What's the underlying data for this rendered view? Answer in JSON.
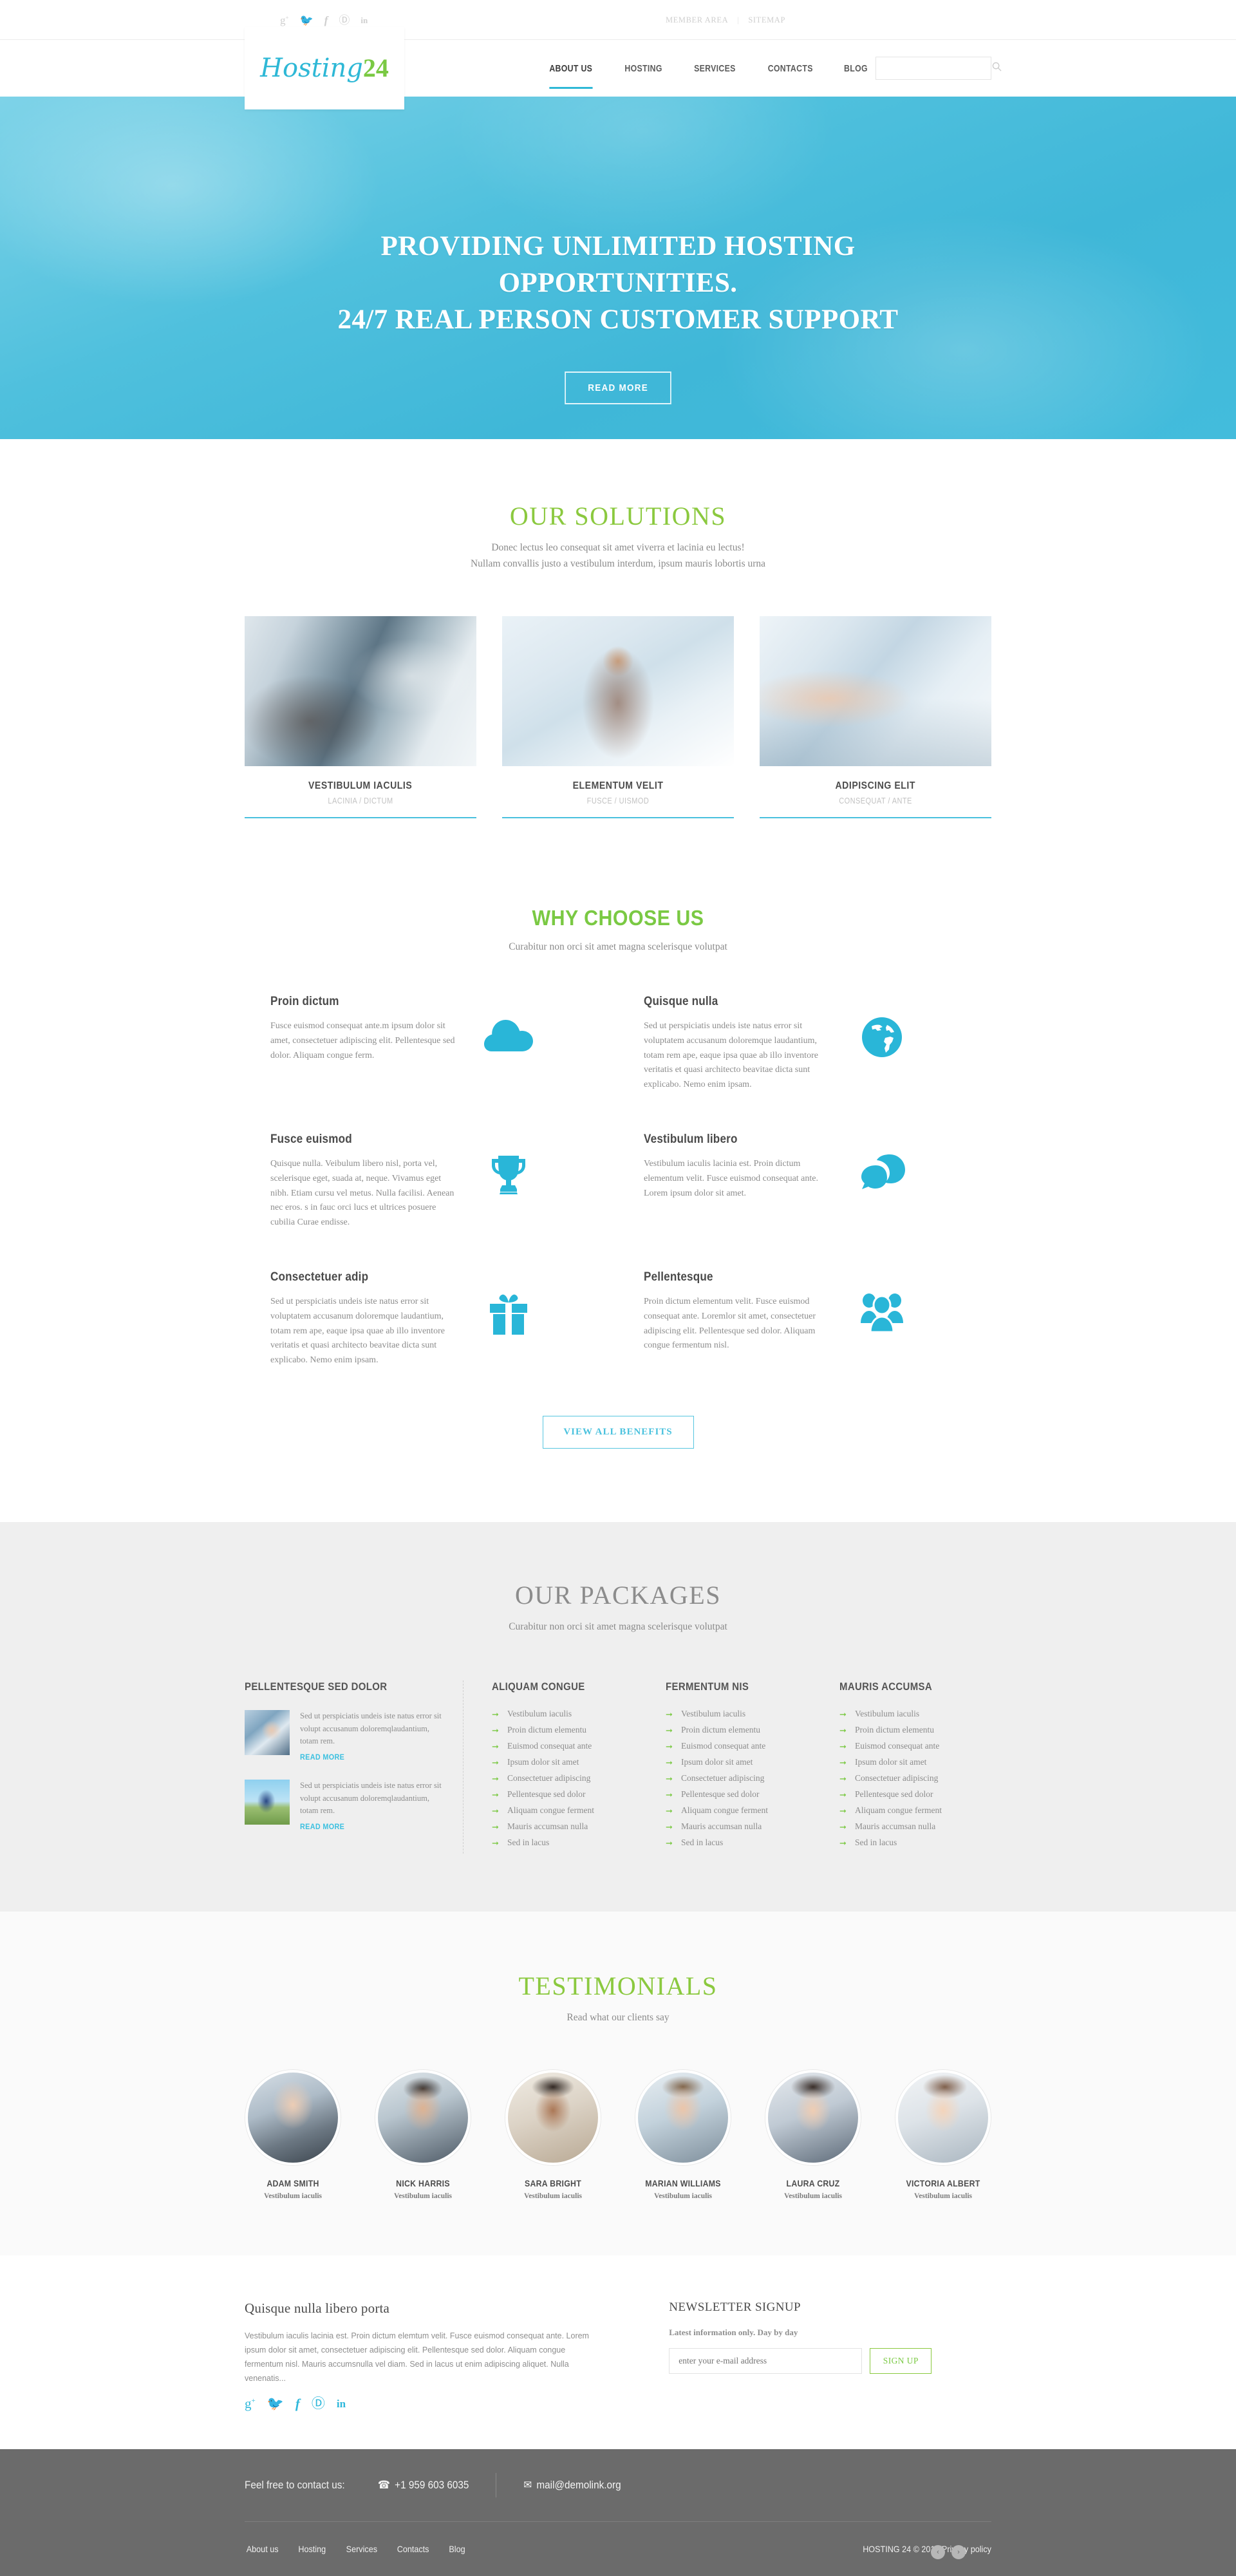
{
  "topbar": {
    "social": [
      "google-plus",
      "twitter",
      "facebook",
      "pinterest",
      "linkedin"
    ],
    "member_area": "MEMBER AREA",
    "separator": "|",
    "sitemap": "SITEMAP"
  },
  "header": {
    "logo_main": "Hosting",
    "logo_accent": "24",
    "nav": [
      {
        "label": "ABOUT US",
        "active": true
      },
      {
        "label": "HOSTING",
        "active": false
      },
      {
        "label": "SERVICES",
        "active": false
      },
      {
        "label": "CONTACTS",
        "active": false
      },
      {
        "label": "BLOG",
        "active": false
      }
    ],
    "search_placeholder": "",
    "search_value": ""
  },
  "hero": {
    "line1": "PROVIDING UNLIMITED HOSTING",
    "line2": "OPPORTUNITIES.",
    "line3": "24/7 REAL PERSON CUSTOMER SUPPORT",
    "button": "READ MORE",
    "bg_color": "#45bddb"
  },
  "solutions": {
    "title": "OUR SOLUTIONS",
    "subtitle_line1": "Donec lectus leo consequat sit amet viverra et lacinia eu lectus!",
    "subtitle_line2": "Nullam convallis justo a vestibulum interdum, ipsum mauris lobortis urna",
    "cards": [
      {
        "title": "VESTIBULUM IACULIS",
        "sub": "LACINIA / DICTUM",
        "image": "hands-on-laptop-photo"
      },
      {
        "title": "ELEMENTUM VELIT",
        "sub": "FUSCE / UISMOD",
        "image": "woman-at-desk-photo"
      },
      {
        "title": "ADIPISCING ELIT",
        "sub": "CONSEQUAT / ANTE",
        "image": "hand-pointing-at-screen-photo"
      }
    ]
  },
  "why": {
    "title": "WHY CHOOSE US",
    "subtitle": "Curabitur non orci sit amet magna scelerisque volutpat",
    "benefits": [
      {
        "title": "Proin dictum",
        "text": "Fusce euismod consequat ante.m ipsum dolor sit amet, consectetuer adipiscing elit. Pellentesque sed dolor. Aliquam congue ferm.",
        "icon": "cloud-icon"
      },
      {
        "title": "Quisque nulla",
        "text": "Sed ut perspiciatis undeis iste natus error sit voluptatem accusanum doloremque laudantium, totam rem ape, eaque ipsa quae ab illo inventore veritatis et quasi architecto beavitae dicta sunt explicabo. Nemo enim ipsam.",
        "icon": "globe-icon"
      },
      {
        "title": "Fusce euismod",
        "text": "Quisque nulla. Veibulum libero nisl, porta vel, scelerisque eget, suada at, neque. Vivamus eget nibh. Etiam cursu vel metus. Nulla facilisi. Aenean nec eros. s in fauc orci lucs et ultrices posuere cubilia Curae endisse.",
        "icon": "trophy-icon"
      },
      {
        "title": "Vestibulum libero",
        "text": "Vestibulum iaculis lacinia est. Proin dictum elementum velit. Fusce euismod consequat ante. Lorem ipsum dolor sit amet.",
        "icon": "chat-bubbles-icon"
      },
      {
        "title": "Consectetuer adip",
        "text": "Sed ut perspiciatis undeis iste natus error sit voluptatem accusanum doloremque laudantium, totam rem ape, eaque ipsa quae ab illo inventore veritatis et quasi architecto beavitae dicta sunt explicabo. Nemo enim ipsam.",
        "icon": "gift-icon"
      },
      {
        "title": "Pellentesque",
        "text": "Proin dictum elementum velit. Fusce euismod consequat ante. Loremlor sit amet, consectetuer adipiscing elit. Pellentesque sed dolor. Aliquam congue fermentum nisl.",
        "icon": "users-group-icon"
      }
    ],
    "button": "VIEW ALL BENEFITS"
  },
  "packages": {
    "title": "OUR PACKAGES",
    "subtitle": "Curabitur non orci sit amet magna scelerisque volutpat",
    "featured": {
      "heading": "PELLENTESQUE SED DOLOR",
      "posts": [
        {
          "image": "woman-at-computer-photo",
          "text": "Sed ut perspiciatis undeis iste natus error sit volupt accusanum doloremqlaudantium, totam rem.",
          "more": "READ MORE"
        },
        {
          "image": "man-with-laptop-outdoors-photo",
          "text": "Sed ut perspiciatis undeis iste natus error sit volupt accusanum doloremqlaudantium, totam rem.",
          "more": "READ MORE"
        }
      ]
    },
    "columns": [
      {
        "heading": "ALIQUAM CONGUE",
        "items": [
          "Vestibulum iaculis",
          "Proin dictum elementu",
          "Euismod consequat ante",
          "Ipsum dolor sit amet",
          "Consectetuer adipiscing",
          "Pellentesque sed dolor",
          "Aliquam congue ferment",
          "Mauris accumsan nulla",
          "Sed in lacus"
        ]
      },
      {
        "heading": "FERMENTUM NIS",
        "items": [
          "Vestibulum iaculis",
          "Proin dictum elementu",
          "Euismod consequat ante",
          "Ipsum dolor sit amet",
          "Consectetuer adipiscing",
          "Pellentesque sed dolor",
          "Aliquam congue ferment",
          "Mauris accumsan nulla",
          "Sed in lacus"
        ]
      },
      {
        "heading": "MAURIS ACCUMSA",
        "items": [
          "Vestibulum iaculis",
          "Proin dictum elementu",
          "Euismod consequat ante",
          "Ipsum dolor sit amet",
          "Consectetuer adipiscing",
          "Pellentesque sed dolor",
          "Aliquam congue ferment",
          "Mauris accumsan nulla",
          "Sed in lacus"
        ]
      }
    ]
  },
  "testimonials": {
    "title": "TESTIMONIALS",
    "subtitle": "Read what our clients say",
    "people": [
      {
        "name": "ADAM SMITH",
        "role": "Vestibulum iaculis",
        "avatar": "older-man-suit-avatar"
      },
      {
        "name": "NICK HARRIS",
        "role": "Vestibulum iaculis",
        "avatar": "young-man-dark-hair-avatar"
      },
      {
        "name": "SARA BRIGHT",
        "role": "Vestibulum iaculis",
        "avatar": "woman-short-hair-avatar"
      },
      {
        "name": "MARIAN WILLIAMS",
        "role": "Vestibulum iaculis",
        "avatar": "young-man-blond-avatar"
      },
      {
        "name": "LAURA CRUZ",
        "role": "Vestibulum iaculis",
        "avatar": "woman-dark-hair-avatar"
      },
      {
        "name": "VICTORIA ALBERT",
        "role": "Vestibulum iaculis",
        "avatar": "smiling-woman-avatar"
      }
    ]
  },
  "footer_top": {
    "about_heading": "Quisque nulla libero porta",
    "about_text": "Vestibulum iaculis lacinia est. Proin dictum elemtum velit. Fusce euismod consequat ante. Lorem ipsum dolor sit amet, consectetuer adipiscing elit. Pellentesque sed dolor. Aliquam congue fermentum nisl. Mauris accumsnulla vel diam. Sed in lacus ut enim adipiscing aliquet. Nulla venenatis...",
    "social": [
      "google-plus",
      "twitter",
      "facebook",
      "pinterest",
      "linkedin"
    ],
    "newsletter_heading": "NEWSLETTER SIGNUP",
    "newsletter_lead": "Latest information only. Day by day",
    "newsletter_placeholder": "enter your e-mail address",
    "newsletter_value": "",
    "newsletter_button": "SIGN UP"
  },
  "footer": {
    "contact_label": "Feel free to contact us:",
    "phone": "+1 959 603 6035",
    "email": "mail@demolink.org",
    "nav": [
      "About us",
      "Hosting",
      "Services",
      "Contacts",
      "Blog"
    ],
    "copyright": "HOSTING 24 © 2015 Privacy policy",
    "fab_left": "‹",
    "fab_right": "›"
  }
}
